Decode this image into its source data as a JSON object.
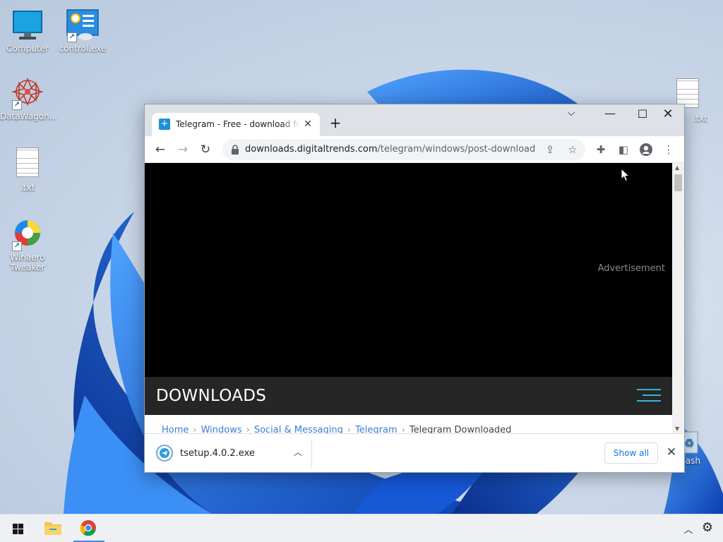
{
  "desktop": {
    "icons": [
      {
        "label": "Computer"
      },
      {
        "label": "control.exe"
      },
      {
        "label": "DataWagon..."
      },
      {
        "label": ".txt"
      },
      {
        "label": "Winaero Tweaker"
      },
      {
        "label": ".txt"
      },
      {
        "label": "ash"
      }
    ]
  },
  "browser": {
    "tab_title": "Telegram - Free - download for Windows",
    "tab_close_glyph": "✕",
    "new_tab_glyph": "+",
    "tab_search_glyph": "⌵",
    "minimize_glyph": "—",
    "maximize_glyph": "☐",
    "close_glyph": "✕",
    "back_glyph": "←",
    "forward_glyph": "→",
    "reload_glyph": "↻",
    "url_host": "downloads.digitaltrends.com",
    "url_path": "/telegram/windows/post-download",
    "share_glyph": "⇪",
    "bookmark_glyph": "☆",
    "extensions_glyph": "✚",
    "sidepanel_glyph": "◧",
    "menu_glyph": "⋮",
    "scroll_up_glyph": "▲",
    "scroll_down_glyph": "▼"
  },
  "page": {
    "ad_label": "Advertisement",
    "section_title": "DOWNLOADS",
    "breadcrumb": [
      "Home",
      "Windows",
      "Social & Messaging",
      "Telegram",
      "Telegram Downloaded"
    ]
  },
  "download_bar": {
    "filename": "tsetup.4.0.2.exe",
    "chevron_glyph": "︿",
    "show_all_label": "Show all",
    "close_glyph": "✕"
  },
  "taskbar": {
    "tray_chevron_glyph": "︿",
    "tray_gear_glyph": "⚙"
  },
  "colors": {
    "accent": "#1a73e8",
    "site_accent": "#35b3d7",
    "wallpaper_blue": "#1e63d8"
  }
}
